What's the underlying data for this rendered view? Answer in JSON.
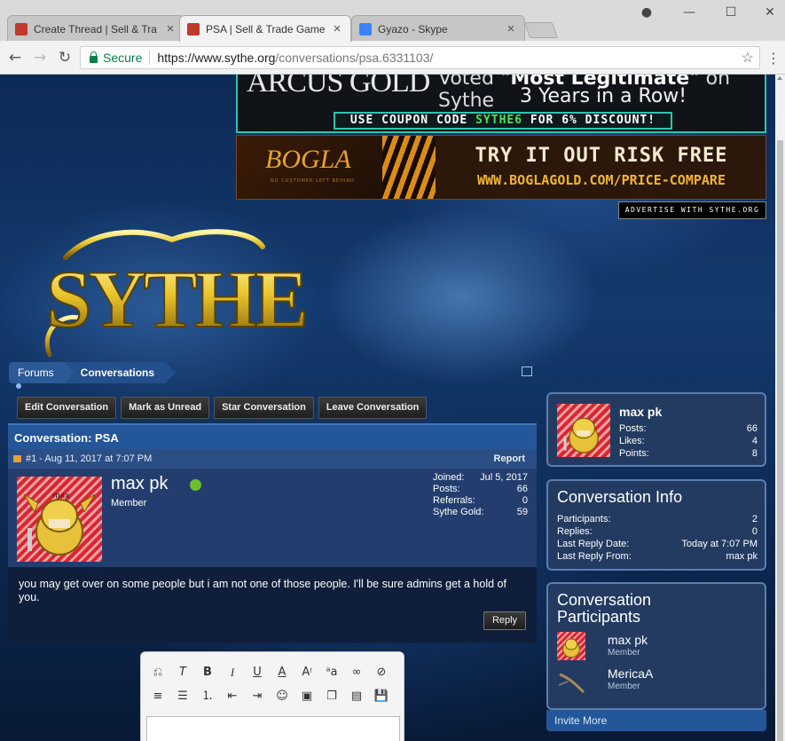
{
  "browser": {
    "tabs": [
      {
        "title": "Create Thread | Sell & Tra",
        "favicon_color": "#c0392b"
      },
      {
        "title": "PSA | Sell & Trade Game",
        "favicon_color": "#c0392b"
      },
      {
        "title": "Gyazo - Skype",
        "favicon_color": "#3b82f6"
      }
    ],
    "secure_label": "Secure",
    "url_host": "https://www.sythe.org",
    "url_path": "/conversations/psa.6331103/"
  },
  "ads": {
    "ad1_brand": "ARCUS GOLD",
    "ad1_line1_prefix": "Voted",
    "ad1_line1_bold": "\"Most Legitimate\"",
    "ad1_line1_suffix": "on Sythe",
    "ad1_line2": "3 Years in a Row!",
    "ad1_coupon_prefix": "USE COUPON CODE",
    "ad1_coupon_code": "SYTHE6",
    "ad1_coupon_suffix": "FOR 6% DISCOUNT!",
    "ad2_brand": "BOGLA",
    "ad2_tagline": "NO CUSTOMER LEFT BEHIND",
    "ad2_line1": "TRY IT OUT RISK FREE",
    "ad2_line2": "WWW.BOGLAGOLD.COM/PRICE-COMPARE",
    "advertise": "ADVERTISE WITH SYTHE.ORG"
  },
  "breadcrumb": [
    "Forums",
    "Conversations"
  ],
  "actions": [
    "Edit Conversation",
    "Mark as Unread",
    "Star Conversation",
    "Leave Conversation"
  ],
  "conversation": {
    "title": "Conversation: PSA",
    "post_meta": "#1 - Aug 11, 2017 at 7:07 PM",
    "report": "Report",
    "username": "max pk",
    "role": "Member",
    "stats": [
      {
        "label": "Joined:",
        "value": "Jul 5, 2017"
      },
      {
        "label": "Posts:",
        "value": "66"
      },
      {
        "label": "Referrals:",
        "value": "0"
      },
      {
        "label": "Sythe Gold:",
        "value": "59"
      }
    ],
    "message": "you may get over on some people but i am not one of those people. I'll be sure admins get a hold of you.",
    "reply": "Reply"
  },
  "sidebar": {
    "user": {
      "name": "max pk",
      "stats": [
        {
          "label": "Posts:",
          "value": "66"
        },
        {
          "label": "Likes:",
          "value": "4"
        },
        {
          "label": "Points:",
          "value": "8"
        }
      ]
    },
    "info": {
      "title": "Conversation Info",
      "stats": [
        {
          "label": "Participants:",
          "value": "2"
        },
        {
          "label": "Replies:",
          "value": "0"
        },
        {
          "label": "Last Reply Date:",
          "value": "Today at 7:07 PM"
        },
        {
          "label": "Last Reply From:",
          "value": "max pk"
        }
      ]
    },
    "participants": {
      "title_line1": "Conversation",
      "title_line2": "Participants",
      "list": [
        {
          "name": "max pk",
          "role": "Member"
        },
        {
          "name": "MericaA",
          "role": "Member"
        }
      ]
    },
    "invite": "Invite More"
  }
}
